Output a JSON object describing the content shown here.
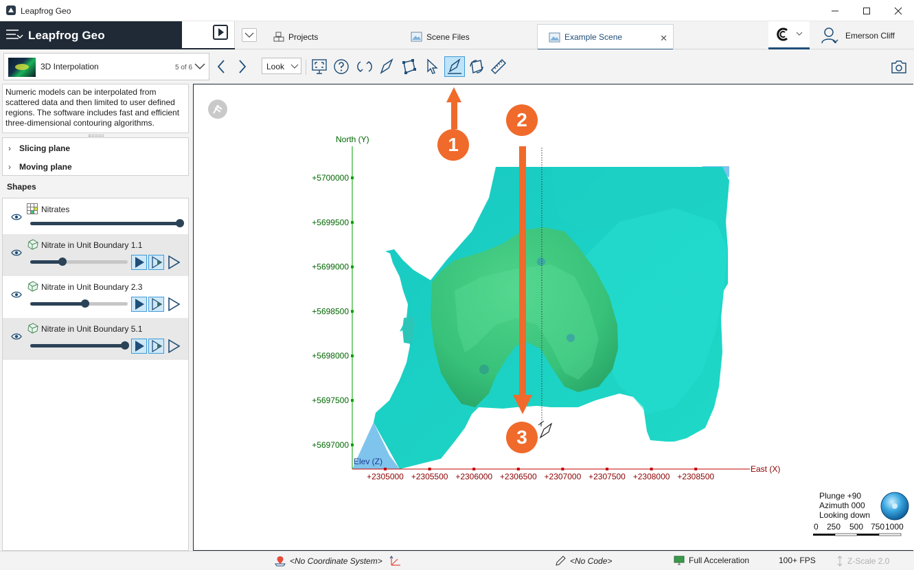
{
  "window": {
    "title": "Leapfrog Geo"
  },
  "brand": {
    "name": "Leapfrog Geo"
  },
  "tabs": [
    {
      "label": "Projects"
    },
    {
      "label": "Scene Files"
    },
    {
      "label": "Example Scene",
      "active": true
    }
  ],
  "user": {
    "name": "Emerson Cliff"
  },
  "toolbar": {
    "scene_title": "3D Interpolation",
    "scene_count": "5 of 6",
    "look_label": "Look"
  },
  "description": "Numeric models can be interpolated from scattered data and then limited to user defined regions. The software includes fast and efficient three-dimensional contouring algorithms.",
  "planes": [
    {
      "label": "Slicing plane"
    },
    {
      "label": "Moving plane"
    }
  ],
  "shapes_header": "Shapes",
  "shapes": [
    {
      "name": "Nitrates",
      "opacity": 1.0,
      "has_render_buttons": false
    },
    {
      "name": "Nitrate in Unit Boundary 1.1",
      "opacity": 0.33,
      "has_render_buttons": true
    },
    {
      "name": "Nitrate in Unit Boundary 2.3",
      "opacity": 0.56,
      "has_render_buttons": true
    },
    {
      "name": "Nitrate in Unit Boundary 5.1",
      "opacity": 0.97,
      "has_render_buttons": true
    }
  ],
  "scene": {
    "y_axis_title": "North (Y)",
    "x_axis_title": "East (X)",
    "z_axis_title": "Elev (Z)",
    "y_ticks": [
      "+5700000",
      "+5699500",
      "+5699000",
      "+5698500",
      "+5698000",
      "+5697500",
      "+5697000"
    ],
    "x_ticks": [
      "+2305000",
      "+2305500",
      "+2306000",
      "+2306500",
      "+2307000",
      "+2307500",
      "+2308000",
      "+2308500"
    ],
    "compass": {
      "plunge": "Plunge +90",
      "azimuth": "Azimuth 000",
      "view": "Looking down"
    },
    "scale_labels": [
      "0",
      "250",
      "500",
      "750",
      "1000"
    ],
    "steps": [
      "1",
      "2",
      "3"
    ],
    "colors": {
      "axis_y": "#00a000",
      "axis_x": "#c00000",
      "label_y": "#006600",
      "label_x": "#8b0000",
      "z_label": "#1f3a93",
      "surface_cyan": "#19d7c8",
      "surface_green": "#35c97a",
      "callout": "#ef6a2b"
    }
  },
  "status": {
    "coordinate_system": "<No Coordinate System>",
    "code": "<No Code>",
    "acceleration": "Full Acceleration",
    "fps": "100+ FPS",
    "z_scale": "Z-Scale 2.0"
  }
}
